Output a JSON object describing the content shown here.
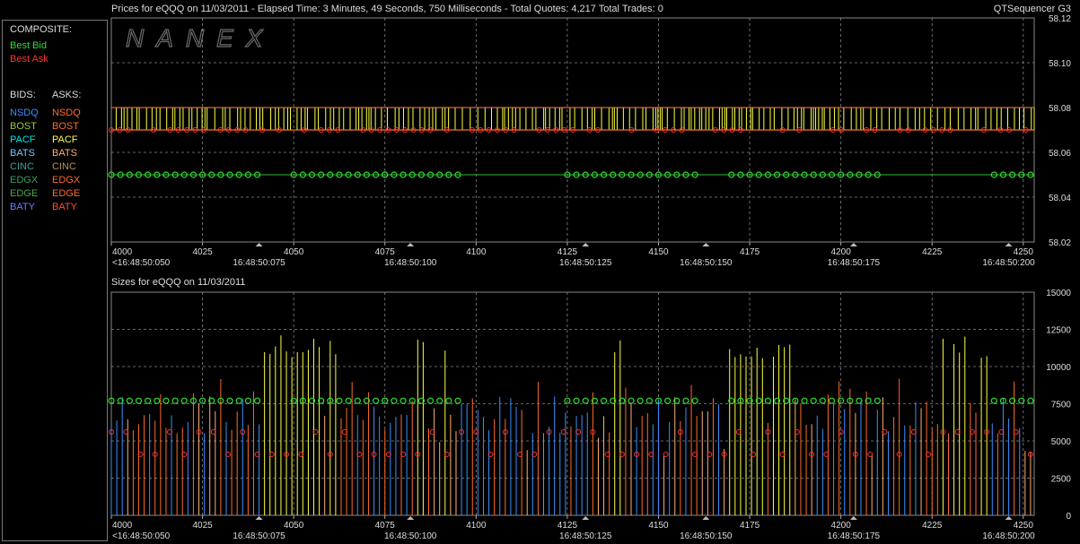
{
  "header": {
    "title": "Prices for  eQQQ  on  11/03/2011  -  Elapsed Time: 3 Minutes, 49 Seconds, 750 Milliseconds  -  Total Quotes: 4,217  Total Trades: 0",
    "app_name": "QTSequencer G3",
    "logo_text": "NANEX"
  },
  "sizes_title": "Sizes for  eQQQ  on  11/03/2011",
  "legend": {
    "composite_label": "COMPOSITE:",
    "best_bid": "Best Bid",
    "best_ask": "Best Ask",
    "bids_label": "BIDS:",
    "asks_label": "ASKS:",
    "bids": [
      "NSDQ",
      "BOST",
      "PACF",
      "BATS",
      "CINC",
      "EDGX",
      "EDGE",
      "BATY"
    ],
    "asks": [
      "NSDQ",
      "BOST",
      "PACF",
      "BATS",
      "CINC",
      "EDGX",
      "EDGE",
      "BATY"
    ],
    "bid_colors": [
      "#3a8fff",
      "#9acd32",
      "#00e5e5",
      "#7ec8ff",
      "#3aa0a0",
      "#3aa060",
      "#4aaa4a",
      "#6a7fff"
    ],
    "ask_colors": [
      "#ff6a2a",
      "#ff6a2a",
      "#ffff50",
      "#ffb070",
      "#b09060",
      "#ff6a2a",
      "#ff6a2a",
      "#ff5030"
    ],
    "best_bid_color": "#33dd33",
    "best_ask_color": "#ff3333"
  },
  "x_axis": {
    "ticks": [
      "4000",
      "4025",
      "4050",
      "4075",
      "4100",
      "4125",
      "4150",
      "4175",
      "4200",
      "4225",
      "4250"
    ],
    "time_labels": [
      "<16:48:50:050",
      "16:48:50:075",
      "16:48:50:100",
      "16:48:50:125",
      "16:48:50:150",
      "16:48:50:175",
      "16:48:50:200"
    ],
    "time_label_positions": [
      4000,
      4040.5,
      4082,
      4130,
      4163,
      4203.5,
      4246
    ]
  },
  "chart_data": [
    {
      "type": "line",
      "title": "Prices for  eQQQ  on  11/03/2011",
      "xlim": [
        4000,
        4253
      ],
      "ylim": [
        58.02,
        58.12
      ],
      "yticks": [
        "58.12",
        "58.10",
        "58.08",
        "58.06",
        "58.04",
        "58.02"
      ],
      "series": [
        {
          "name": "Best Ask",
          "pattern": "alternating 58.08 / 58.07",
          "values_top": 58.08,
          "values_bottom": 58.07
        },
        {
          "name": "Best Bid",
          "values": 58.05
        }
      ],
      "grid": true
    },
    {
      "type": "bar",
      "title": "Sizes for  eQQQ  on  11/03/2011",
      "xlim": [
        4000,
        4253
      ],
      "ylim": [
        0,
        15000
      ],
      "yticks": [
        "15000",
        "12500",
        "10000",
        "7500",
        "5000",
        "2500",
        "0"
      ],
      "series": [
        {
          "name": "Best Bid",
          "typical_value": 7700
        },
        {
          "name": "Best Ask",
          "typical_values": [
            5600,
            4100
          ]
        },
        {
          "name": "PACF",
          "peak_value": 12200
        }
      ],
      "grid": true
    }
  ]
}
